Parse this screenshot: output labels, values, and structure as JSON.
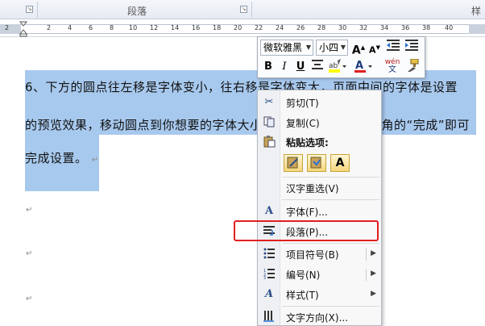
{
  "ribbon": {
    "group_label": "段落",
    "right_label": "样"
  },
  "ruler": {
    "ticks": [
      "2",
      "2",
      "4",
      "6",
      "8",
      "10",
      "12",
      "14",
      "16",
      "18",
      "20",
      "22",
      "24",
      "26",
      "28",
      "30",
      "32",
      "34",
      "36",
      "38",
      "40"
    ]
  },
  "document": {
    "lines": [
      "6、下方的圆点往左移是字体变小，往右移是字体变大，页面中间的字体是设置",
      "的预览效果，移动圆点到你想要的字体大小",
      "完成设置。"
    ],
    "line2_tail": "上角的“完成”即可",
    "return_mark": "↵"
  },
  "mini_toolbar": {
    "font_name": "微软雅黑",
    "font_size": "小四",
    "grow_font": "A",
    "shrink_font": "A",
    "bold": "B",
    "italic": "I",
    "underline": "U",
    "font_color": "A",
    "phonetic": "wén",
    "phonetic_char": "文"
  },
  "context_menu": {
    "items": [
      {
        "label": "剪切(T)",
        "icon": "scissors-icon"
      },
      {
        "label": "复制(C)",
        "icon": "copy-icon"
      },
      {
        "label": "粘贴选项:",
        "icon": "paste-icon"
      },
      {
        "label": "汉字重选(V)",
        "icon": ""
      },
      {
        "label": "字体(F)...",
        "icon": "font-icon"
      },
      {
        "label": "段落(P)...",
        "icon": "paragraph-icon"
      },
      {
        "label": "项目符号(B)",
        "icon": "bullets-icon"
      },
      {
        "label": "编号(N)",
        "icon": "numbering-icon"
      },
      {
        "label": "样式(T)",
        "icon": "styles-icon"
      },
      {
        "label": "文字方向(X)...",
        "icon": "text-direction-icon"
      }
    ],
    "paste_options": [
      "A"
    ]
  },
  "colors": {
    "selection": "#a8c9ee",
    "highlight_border": "#e02020",
    "font_color_bar": "#e02020",
    "highlight_color_bar": "#ffff00"
  }
}
